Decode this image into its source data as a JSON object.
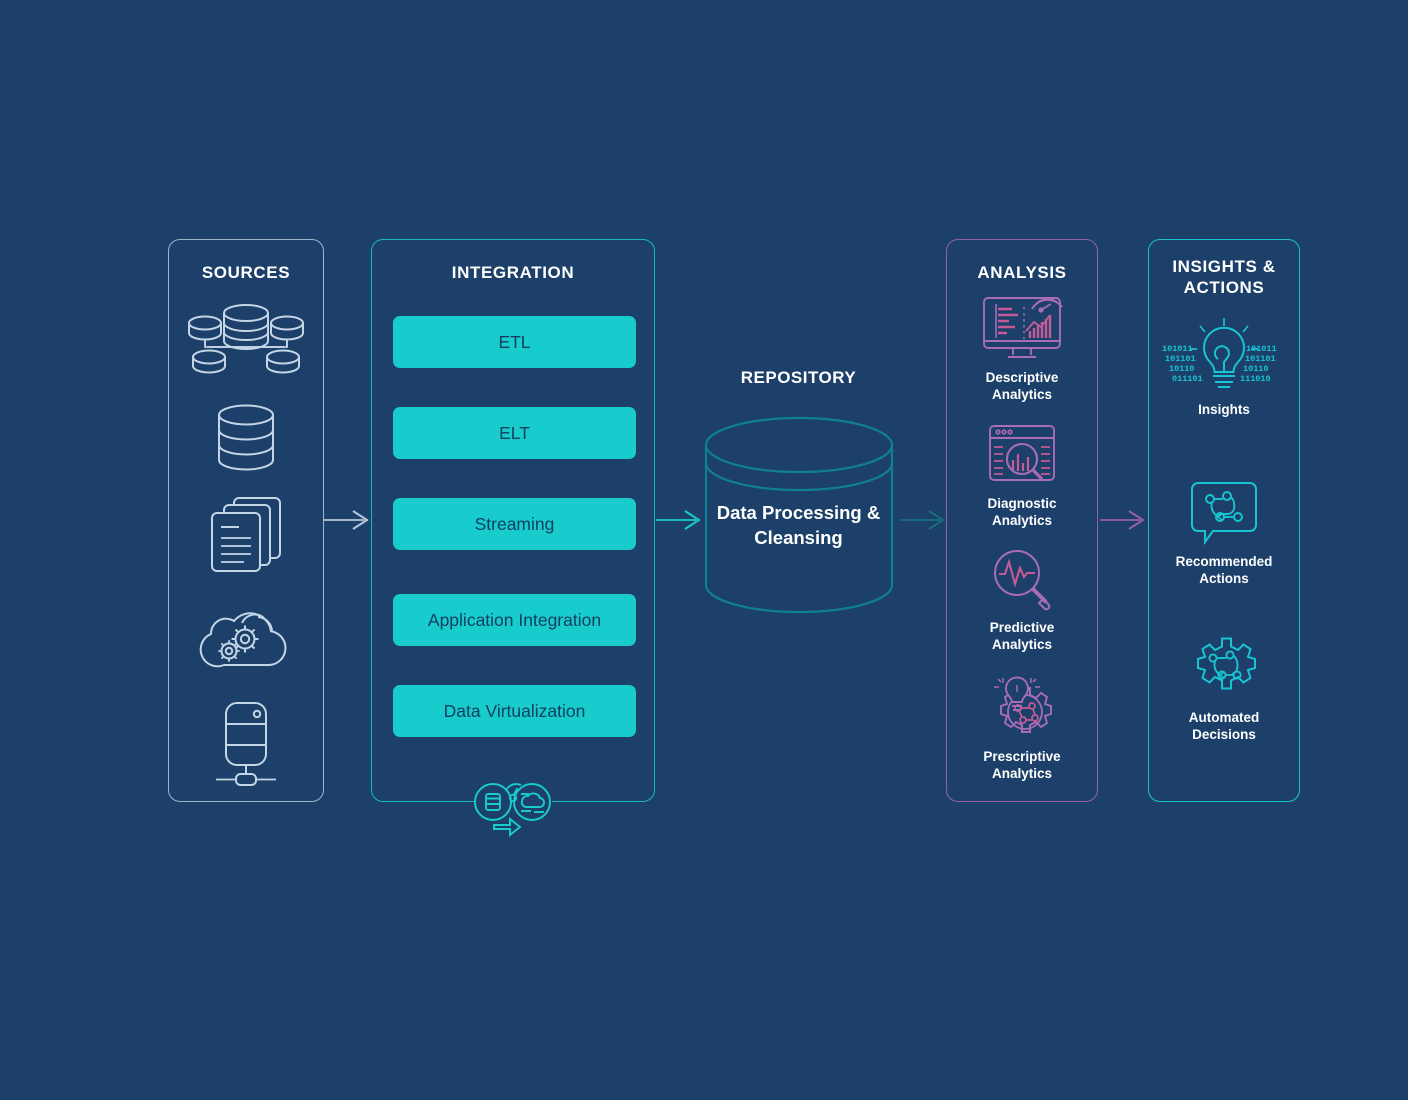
{
  "background_color": "#1c4069",
  "colors": {
    "sources_accent": "#9fb6cf",
    "integration_accent": "#17b8c4",
    "chip_fill": "#18ccce",
    "chip_text": "#11405f",
    "repository_accent": "#107f93",
    "analysis_accent": "#9a5fa8",
    "insights_accent": "#17c2cf",
    "title_text": "#ffffff"
  },
  "sources": {
    "title": "SOURCES",
    "icons": [
      {
        "name": "distributed-databases-icon",
        "label": ""
      },
      {
        "name": "database-cylinder-icon",
        "label": ""
      },
      {
        "name": "documents-stack-icon",
        "label": ""
      },
      {
        "name": "cloud-gears-icon",
        "label": ""
      },
      {
        "name": "server-node-icon",
        "label": ""
      }
    ]
  },
  "integration": {
    "title": "INTEGRATION",
    "chips": [
      {
        "label": "ETL"
      },
      {
        "label": "ELT"
      },
      {
        "label": "Streaming"
      },
      {
        "label": "Application Integration"
      },
      {
        "label": "Data Virtualization"
      }
    ],
    "footer_icon": "data-migration-cloud-icon"
  },
  "repository": {
    "title": "REPOSITORY",
    "cylinder_label_line1": "Data Processing &",
    "cylinder_label_line2": "Cleansing"
  },
  "analysis": {
    "title": "ANALYSIS",
    "items": [
      {
        "icon": "monitor-charts-icon",
        "label_line1": "Descriptive",
        "label_line2": "Analytics"
      },
      {
        "icon": "browser-magnifier-bars-icon",
        "label_line1": "Diagnostic",
        "label_line2": "Analytics"
      },
      {
        "icon": "magnifier-pulse-icon",
        "label_line1": "Predictive",
        "label_line2": "Analytics"
      },
      {
        "icon": "gear-lightbulb-icon",
        "label_line1": "Prescriptive",
        "label_line2": "Analytics"
      }
    ]
  },
  "insights": {
    "title_line1": "INSIGHTS &",
    "title_line2": "ACTIONS",
    "items": [
      {
        "icon": "lightbulb-binary-icon",
        "label_line1": "Insights",
        "label_line2": ""
      },
      {
        "icon": "speech-bubble-flow-icon",
        "label_line1": "Recommended",
        "label_line2": "Actions"
      },
      {
        "icon": "gear-flow-icon",
        "label_line1": "Automated",
        "label_line2": "Decisions"
      }
    ],
    "binary_text": {
      "left": [
        "101011",
        "101101",
        "10110",
        "011101"
      ],
      "right": [
        "101011",
        "101101",
        "10110",
        "111010"
      ]
    }
  },
  "arrows": [
    {
      "name": "arrow-sources-to-integration",
      "color": "#b7c8da"
    },
    {
      "name": "arrow-integration-to-repository",
      "color": "#18ccce"
    },
    {
      "name": "arrow-repository-to-analysis",
      "color": "#16707f"
    },
    {
      "name": "arrow-analysis-to-insights",
      "color": "#9a5fa8"
    }
  ]
}
